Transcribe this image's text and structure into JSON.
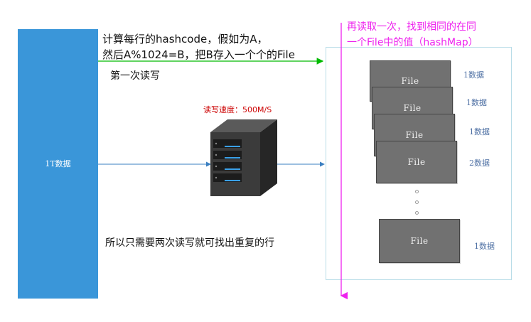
{
  "source": {
    "label": "1T数据"
  },
  "hash_step": {
    "line1": "计算每行的hashcode，假如为A，",
    "line2": "然后A%1024=B，把B存入一个个的File"
  },
  "pass_label": "第一次读写",
  "speed_label": "读写速度：500M/S",
  "conclusion": "所以只需要两次读写就可找出重复的行",
  "reread": {
    "line1": "再读取一次，找到相同的在同",
    "line2": "一个File中的值（hashMap）"
  },
  "files": [
    {
      "label": "File",
      "count": "1数据"
    },
    {
      "label": "File",
      "count": "1数据"
    },
    {
      "label": "File",
      "count": "1数据"
    },
    {
      "label": "File",
      "count": "2数据"
    },
    {
      "label": "File",
      "count": "1数据"
    }
  ],
  "colors": {
    "source_block": "#3a96d9",
    "hash_arrow": "#00bb00",
    "reread_arrow": "#ee22ee",
    "flow_arrow": "#3a7fc1",
    "speed_text": "#cc0000"
  },
  "icons": {
    "server": "server-icon"
  }
}
